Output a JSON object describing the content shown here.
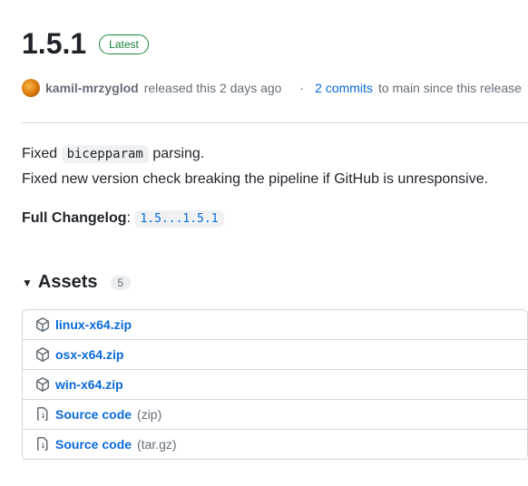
{
  "release": {
    "title": "1.5.1",
    "badge": "Latest",
    "author": "kamil-mrzyglod",
    "released_text": "released this 2 days ago",
    "commits_link": "2 commits",
    "commits_tail": "to main since this release",
    "body_line1_pre": "Fixed ",
    "body_code": "bicepparam",
    "body_line1_post": " parsing.",
    "body_line2": "Fixed new version check breaking the pipeline if GitHub is unresponsive.",
    "changelog_label": "Full Changelog",
    "compare": "1.5...1.5.1"
  },
  "assets": {
    "title": "Assets",
    "count": "5",
    "items": [
      {
        "name": "linux-x64.zip",
        "icon": "package"
      },
      {
        "name": "osx-x64.zip",
        "icon": "package"
      },
      {
        "name": "win-x64.zip",
        "icon": "package"
      },
      {
        "name": "Source code",
        "suffix": "(zip)",
        "icon": "file-zip"
      },
      {
        "name": "Source code",
        "suffix": "(tar.gz)",
        "icon": "file-zip"
      }
    ]
  }
}
